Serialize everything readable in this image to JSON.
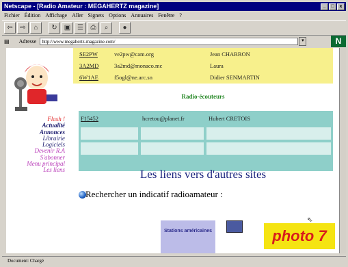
{
  "window": {
    "title": "Netscape - [Radio Amateur : MEGAHERTZ magazine]",
    "controls": [
      "_",
      "□",
      "x"
    ]
  },
  "menu": {
    "items": [
      "Fichier",
      "Édition",
      "Affichage",
      "Aller",
      "Signets",
      "Options",
      "Annuaires",
      "Fenêtre",
      "?"
    ]
  },
  "toolbar": {
    "buttons": [
      "back-icon",
      "forward-icon",
      "home-icon",
      "reload-icon",
      "images-icon",
      "open-icon",
      "print-icon",
      "find-icon",
      "stop-icon"
    ]
  },
  "address": {
    "label": "Adresse",
    "value": "http://www.megahertz-magazine.com/"
  },
  "sidebar": {
    "links": [
      {
        "label": "Flash !",
        "color": "#e01f1f"
      },
      {
        "label": "Actualité",
        "color": "#1b1b6e"
      },
      {
        "label": "Annonces",
        "color": "#1b1b6e"
      },
      {
        "label": "Librairie",
        "color": "#1b1b6e"
      },
      {
        "label": "Logiciels",
        "color": "#1b1b6e"
      },
      {
        "label": "Devenir R.A",
        "color": "#b83ab8"
      },
      {
        "label": "S'abonner",
        "color": "#b83ab8"
      },
      {
        "label": "Menu principal",
        "color": "#b83ab8"
      },
      {
        "label": "Les liens",
        "color": "#b83ab8"
      }
    ]
  },
  "amateurs": [
    {
      "call": "SE2PW",
      "email": "ve2pw@cam.org",
      "name": "Jean CHARRON"
    },
    {
      "call": "3A2MD",
      "email": "3a2md@monaco.mc",
      "name": "Laura"
    },
    {
      "call": "6W1AE",
      "email": "f5ogl@ne.arc.sn",
      "name": "Didier SENMARTIN"
    }
  ],
  "listeners_title": "Radio-écouteurs",
  "listeners": [
    {
      "call": "F15452",
      "email": "hcretou@planet.fr",
      "name": "Hubert CRETOIS"
    }
  ],
  "liens_title": "Les liens vers d'autres sites",
  "search_label": "Rechercher un indicatif radioamateur :",
  "stations_button": "Stations américaines",
  "photo_caption": "photo 7",
  "status": {
    "text": "Document: Chargé",
    "right": ""
  }
}
